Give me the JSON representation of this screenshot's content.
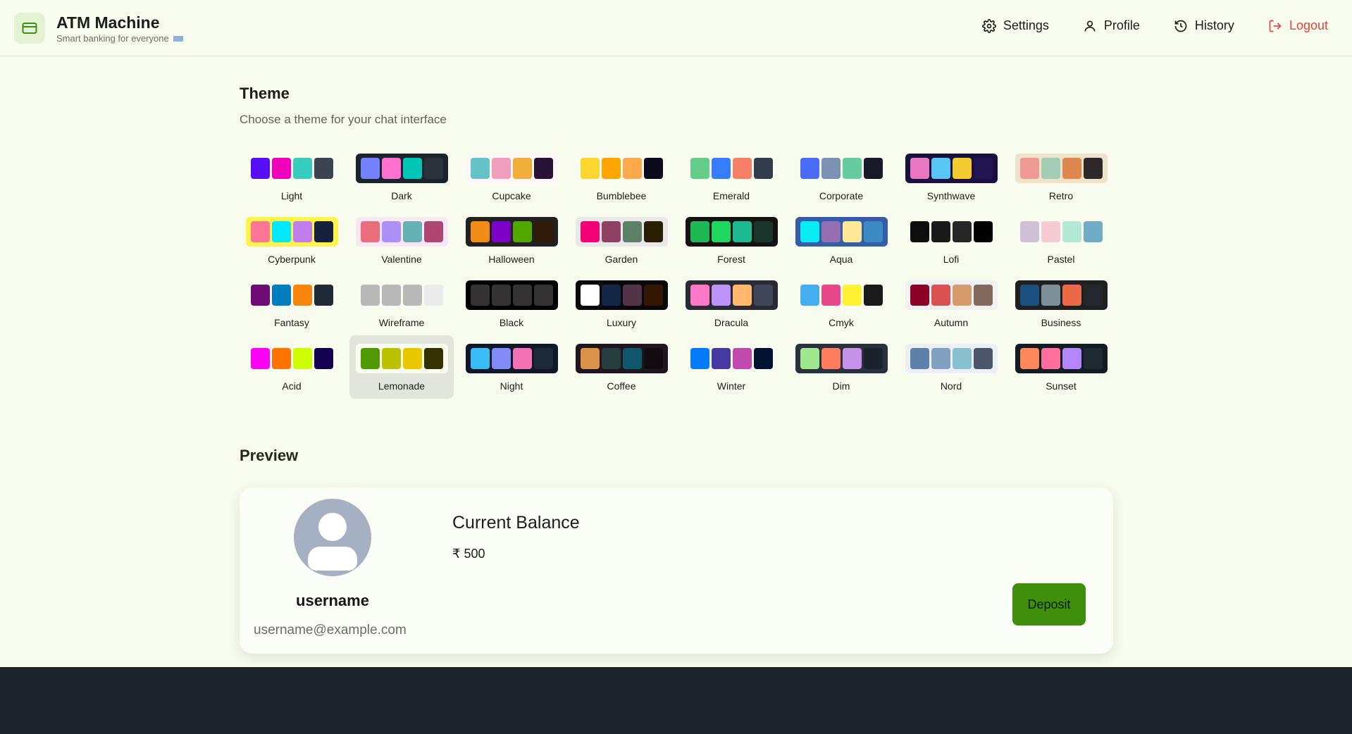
{
  "header": {
    "title": "ATM Machine",
    "subtitle": "Smart banking for everyone",
    "nav": [
      {
        "label": "Settings",
        "icon": "gear-icon"
      },
      {
        "label": "Profile",
        "icon": "user-icon"
      },
      {
        "label": "History",
        "icon": "history-icon"
      },
      {
        "label": "Logout",
        "icon": "logout-icon"
      }
    ]
  },
  "theme_section": {
    "title": "Theme",
    "subtitle": "Choose a theme for your chat interface",
    "selected": "Lemonade",
    "themes": [
      {
        "name": "Light",
        "colors": [
          "#570df8",
          "#f000b8",
          "#37cdbe",
          "#3d4451"
        ],
        "border": "transparent"
      },
      {
        "name": "Dark",
        "colors": [
          "#7582ff",
          "#ff71cf",
          "#00c7b5",
          "#2a323c"
        ],
        "border": "#1d232a"
      },
      {
        "name": "Cupcake",
        "colors": [
          "#65c3c8",
          "#ef9fbc",
          "#eeaf3a",
          "#291334"
        ],
        "border": "#faf7f5"
      },
      {
        "name": "Bumblebee",
        "colors": [
          "#f9d72f",
          "#ffa500",
          "#ffa94d",
          "#0a0a1a"
        ],
        "border": "transparent"
      },
      {
        "name": "Emerald",
        "colors": [
          "#66cc8a",
          "#377cfb",
          "#f68067",
          "#333c4d"
        ],
        "border": "transparent"
      },
      {
        "name": "Corporate",
        "colors": [
          "#4b6bfb",
          "#7b92b2",
          "#67cba0",
          "#181a2a"
        ],
        "border": "transparent"
      },
      {
        "name": "Synthwave",
        "colors": [
          "#e779c1",
          "#58c7f3",
          "#f3cc30",
          "#221551"
        ],
        "border": "#1a103d"
      },
      {
        "name": "Retro",
        "colors": [
          "#ef9995",
          "#a4cbb4",
          "#dc8850",
          "#2e282a"
        ],
        "border": "#ece3ca"
      },
      {
        "name": "Cyberpunk",
        "colors": [
          "#ff7598",
          "#00e8ff",
          "#c07eec",
          "#16213e"
        ],
        "border": "#fff248"
      },
      {
        "name": "Valentine",
        "colors": [
          "#e96d7b",
          "#a991f7",
          "#66b1b3",
          "#af4670"
        ],
        "border": "#fae7f4"
      },
      {
        "name": "Halloween",
        "colors": [
          "#f28c18",
          "#7e00c6",
          "#51a800",
          "#2f1b05"
        ],
        "border": "#212121"
      },
      {
        "name": "Garden",
        "colors": [
          "#f40076",
          "#8e4162",
          "#5c7f67",
          "#291e00"
        ],
        "border": "#e9e7e7"
      },
      {
        "name": "Forest",
        "colors": [
          "#1eb854",
          "#1fd65f",
          "#1db990",
          "#19362d"
        ],
        "border": "#171212"
      },
      {
        "name": "Aqua",
        "colors": [
          "#09ecf3",
          "#966fb3",
          "#ffe999",
          "#3b8ac4"
        ],
        "border": "#345da7"
      },
      {
        "name": "Lofi",
        "colors": [
          "#0d0d0d",
          "#1a1919",
          "#262626",
          "#000000"
        ],
        "border": "transparent"
      },
      {
        "name": "Pastel",
        "colors": [
          "#d1c1d7",
          "#f6cbd1",
          "#b4e9d6",
          "#70acc7"
        ],
        "border": "transparent"
      },
      {
        "name": "Fantasy",
        "colors": [
          "#6e0b75",
          "#007ebd",
          "#f8860d",
          "#1f2937"
        ],
        "border": "transparent"
      },
      {
        "name": "Wireframe",
        "colors": [
          "#b8b8b8",
          "#b8b8b8",
          "#b8b8b8",
          "#ebebeb"
        ],
        "border": "transparent"
      },
      {
        "name": "Black",
        "colors": [
          "#343232",
          "#343232",
          "#343232",
          "#343232"
        ],
        "border": "#000000"
      },
      {
        "name": "Luxury",
        "colors": [
          "#ffffff",
          "#152747",
          "#513448",
          "#331800"
        ],
        "border": "#09090b"
      },
      {
        "name": "Dracula",
        "colors": [
          "#ff79c6",
          "#bd93f9",
          "#ffb86c",
          "#414558"
        ],
        "border": "#282a36"
      },
      {
        "name": "Cmyk",
        "colors": [
          "#45aeee",
          "#e8488a",
          "#fff232",
          "#1a1a1a"
        ],
        "border": "transparent"
      },
      {
        "name": "Autumn",
        "colors": [
          "#8c0327",
          "#d85251",
          "#d59b6a",
          "#826a5c"
        ],
        "border": "#f1f1f1"
      },
      {
        "name": "Business",
        "colors": [
          "#1c4e80",
          "#7c909a",
          "#ea6947",
          "#23282e"
        ],
        "border": "#202020"
      },
      {
        "name": "Acid",
        "colors": [
          "#ff00f4",
          "#ff7400",
          "#cbfd03",
          "#140152"
        ],
        "border": "transparent"
      },
      {
        "name": "Lemonade",
        "colors": [
          "#519903",
          "#bbc300",
          "#e9c800",
          "#343300"
        ],
        "border": "#f8fdef"
      },
      {
        "name": "Night",
        "colors": [
          "#38bdf8",
          "#818cf8",
          "#f471b5",
          "#1e293b"
        ],
        "border": "#0f1729"
      },
      {
        "name": "Coffee",
        "colors": [
          "#db924b",
          "#263e3f",
          "#10576d",
          "#120c12"
        ],
        "border": "#20161f"
      },
      {
        "name": "Winter",
        "colors": [
          "#047aff",
          "#463aa2",
          "#c148ac",
          "#021431"
        ],
        "border": "transparent"
      },
      {
        "name": "Dim",
        "colors": [
          "#9fe88d",
          "#ff7d5c",
          "#c792e9",
          "#1c212b"
        ],
        "border": "#2a303c"
      },
      {
        "name": "Nord",
        "colors": [
          "#5e81ac",
          "#81a1c1",
          "#88c0d0",
          "#4c566a"
        ],
        "border": "#eceff4"
      },
      {
        "name": "Sunset",
        "colors": [
          "#ff865b",
          "#fd6f9c",
          "#b387fa",
          "#1f2a33"
        ],
        "border": "#121c22"
      }
    ]
  },
  "preview": {
    "title": "Preview",
    "username": "username",
    "email": "username@example.com",
    "balance_title": "Current Balance",
    "balance_value": "₹ 500",
    "deposit_label": "Deposit"
  }
}
